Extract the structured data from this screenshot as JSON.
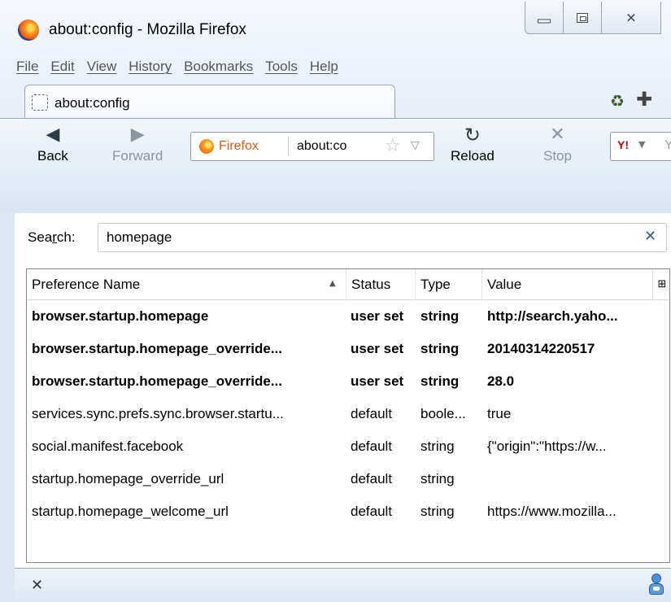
{
  "window": {
    "title": "about:config - Mozilla Firefox",
    "close_glyph": "✕"
  },
  "menu": {
    "items": [
      {
        "label": "File"
      },
      {
        "label": "Edit"
      },
      {
        "label": "View"
      },
      {
        "label": "History"
      },
      {
        "label": "Bookmarks"
      },
      {
        "label": "Tools"
      },
      {
        "label": "Help"
      }
    ]
  },
  "tabs": [
    {
      "label": "about:config"
    }
  ],
  "toolbar": {
    "back_label": "Back",
    "forward_label": "Forward",
    "reload_label": "Reload",
    "stop_label": "Stop"
  },
  "urlbar": {
    "identity_label": "Firefox",
    "url": "about:co"
  },
  "searchbar": {
    "engine_glyph": "Y!",
    "text": "Y"
  },
  "filter": {
    "label_prefix": "Sea",
    "label_accel": "r",
    "label_suffix": "ch:",
    "value": "homepage"
  },
  "table": {
    "columns": [
      "Preference Name",
      "Status",
      "Type",
      "Value"
    ],
    "rows": [
      {
        "name": "browser.startup.homepage",
        "status": "user set",
        "type": "string",
        "value": "http://search.yaho...",
        "bold": true
      },
      {
        "name": "browser.startup.homepage_override...",
        "status": "user set",
        "type": "string",
        "value": "20140314220517",
        "bold": true
      },
      {
        "name": "browser.startup.homepage_override...",
        "status": "user set",
        "type": "string",
        "value": "28.0",
        "bold": true
      },
      {
        "name": "services.sync.prefs.sync.browser.startu...",
        "status": "default",
        "type": "boole...",
        "value": "true",
        "bold": false
      },
      {
        "name": "social.manifest.facebook",
        "status": "default",
        "type": "string",
        "value": "{\"origin\":\"https://w...",
        "bold": false
      },
      {
        "name": "startup.homepage_override_url",
        "status": "default",
        "type": "string",
        "value": "",
        "bold": false
      },
      {
        "name": "startup.homepage_welcome_url",
        "status": "default",
        "type": "string",
        "value": "https://www.mozilla...",
        "bold": false
      }
    ]
  },
  "icons": {
    "back": "back-arrow-icon",
    "forward": "forward-arrow-icon",
    "reload": "reload-icon",
    "stop": "stop-icon",
    "bookmark": "star-icon",
    "sync": "sync-icon",
    "new_tab": "new-tab-icon",
    "addon": "addon-icon"
  }
}
